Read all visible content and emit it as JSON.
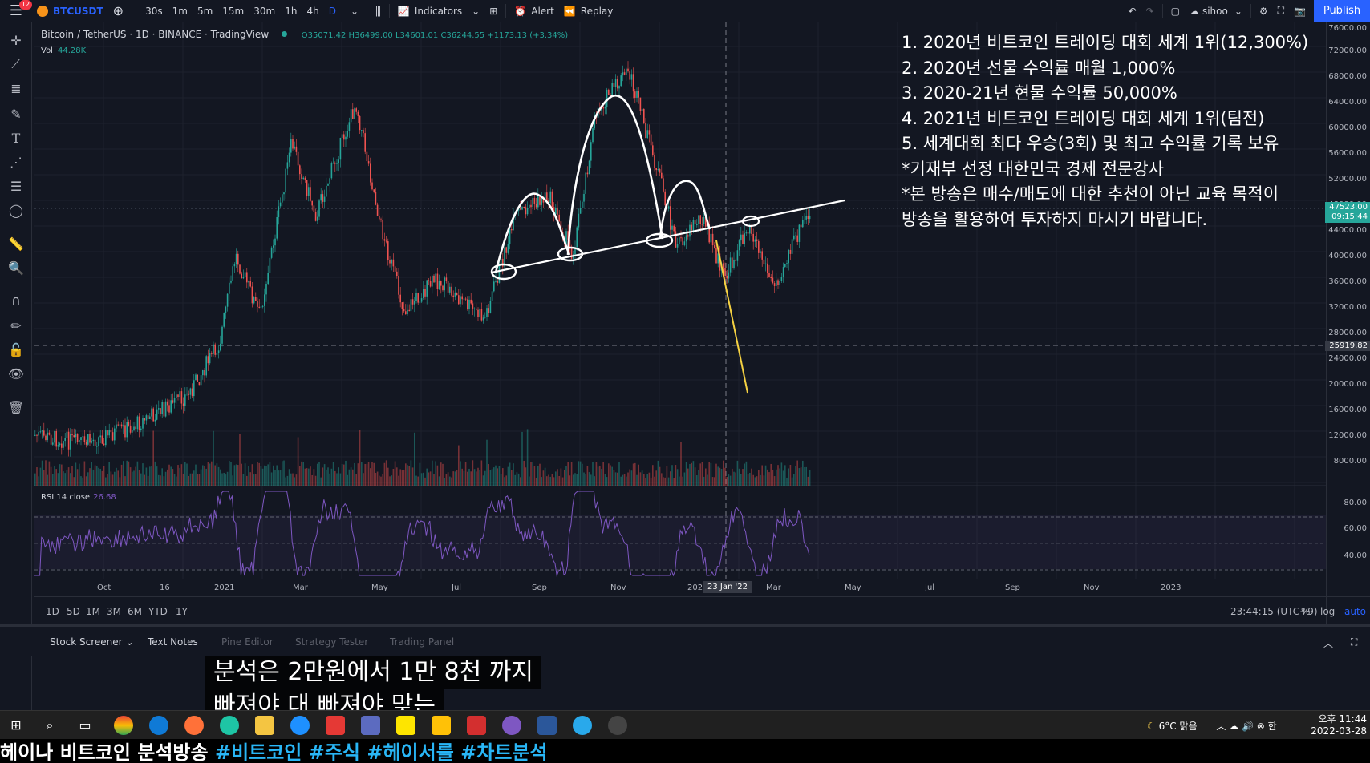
{
  "topbar": {
    "notification_count": "12",
    "symbol": "BTCUSDT",
    "intervals": [
      "30s",
      "1m",
      "5m",
      "15m",
      "30m",
      "1h",
      "4h",
      "D"
    ],
    "active_interval": "D",
    "indicators_label": "Indicators",
    "alert_label": "Alert",
    "replay_label": "Replay",
    "user": "sihoo",
    "publish_label": "Publish"
  },
  "legend": {
    "title": "Bitcoin / TetherUS · 1D · BINANCE · TradingView",
    "ohlc": "O35071.42 H36499.00 L34601.01 C36244.55 +1173.13 (+3.34%)",
    "vol_label": "Vol",
    "vol_value": "44.28K",
    "rsi_label": "RSI 14 close",
    "rsi_value": "26.68"
  },
  "price_axis": {
    "labels": [
      "76000.00",
      "72000.00",
      "68000.00",
      "64000.00",
      "60000.00",
      "56000.00",
      "52000.00",
      "48000.00",
      "44000.00",
      "40000.00",
      "36000.00",
      "32000.00",
      "28000.00",
      "24000.00",
      "20000.00",
      "16000.00",
      "12000.00",
      "8000.00"
    ],
    "current_price": "47523.00",
    "countdown": "09:15:44",
    "crosshair_price": "25919.82",
    "rsi_labels": [
      "80.00",
      "60.00",
      "40.00"
    ]
  },
  "time_axis": {
    "labels": [
      "Oct",
      "16",
      "2021",
      "Mar",
      "May",
      "Jul",
      "Sep",
      "Nov",
      "202",
      "Mar",
      "May",
      "Jul",
      "Sep",
      "Nov",
      "2023"
    ],
    "crosshair_date": "23 Jan '22"
  },
  "notes": [
    "1. 2020년 비트코인 트레이딩 대회 세계 1위(12,300%)",
    "2. 2020년 선물 수익률 매월 1,000%",
    "3. 2020-21년 현물 수익률 50,000%",
    "4. 2021년 비트코인 트레이딩 대회 세계 1위(팀전)",
    "5. 세계대회 최다 우승(3회) 및 최고 수익률 기록 보유",
    "*기재부 선정 대한민국 경제 전문강사",
    "*본 방송은 매수/매도에 대한 추천이 아닌 교육 목적이",
    "방송을 활용하여 투자하지 마시기 바랍니다."
  ],
  "ranges": {
    "items": [
      "1D",
      "5D",
      "1M",
      "3M",
      "6M",
      "YTD",
      "1Y"
    ],
    "clock": "23:44:15 (UTC+9)",
    "percent": "%",
    "log": "log",
    "auto": "auto"
  },
  "panel": {
    "tabs": [
      "Stock Screener",
      "Text Notes",
      "Pine Editor",
      "Strategy Tester",
      "Trading Panel"
    ]
  },
  "caption": {
    "line1": "분석은 2만원에서 1만 8천 까지",
    "line2": "빠져야 대 빠져야 맞는"
  },
  "taskbar": {
    "weather": "6°C 맑음",
    "time": "오후 11:44",
    "date": "2022-03-28"
  },
  "ticker": {
    "text": "헤이나 비트코인 분석방송 ",
    "tags": "#비트코인 #주식 #헤이서를 #차트분석"
  },
  "colors": {
    "background": "#131722",
    "up": "#26a69a",
    "down": "#ef5350",
    "accent": "#2962ff",
    "rsi": "#7e57c2",
    "drawing": "#ffffff",
    "highlight_line": "#f5d142"
  }
}
